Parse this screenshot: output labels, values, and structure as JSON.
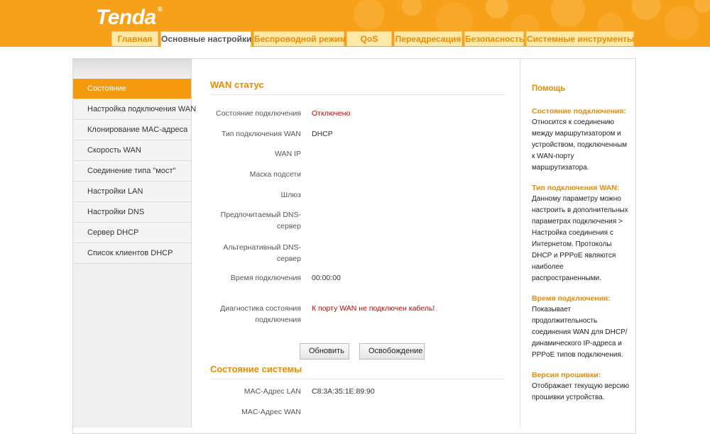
{
  "brand": {
    "logo": "Tenda",
    "registered": "®"
  },
  "nav": {
    "tabs": [
      {
        "label": "Главная",
        "active": false
      },
      {
        "label": "Основные настройки",
        "active": true
      },
      {
        "label": "Беспроводной режим",
        "active": false
      },
      {
        "label": "QoS",
        "active": false
      },
      {
        "label": "Переадресация",
        "active": false
      },
      {
        "label": "Безопасность",
        "active": false
      },
      {
        "label": "Системные инструменты",
        "active": false
      }
    ]
  },
  "sidebar": {
    "items": [
      {
        "label": "Состояние",
        "active": true
      },
      {
        "label": "Настройка подключения WAN",
        "active": false
      },
      {
        "label": "Клонирование MAC-адреса",
        "active": false
      },
      {
        "label": "Скорость WAN",
        "active": false
      },
      {
        "label": "Соединение типа \"мост\"",
        "active": false
      },
      {
        "label": "Настройки LAN",
        "active": false
      },
      {
        "label": "Настройки DNS",
        "active": false
      },
      {
        "label": "Сервер DHCP",
        "active": false
      },
      {
        "label": "Список клиентов DHCP",
        "active": false
      }
    ]
  },
  "main": {
    "wan_title": "WAN статус",
    "wan_rows": [
      {
        "label": "Состояние подключения",
        "value": "Отключено",
        "alert": true
      },
      {
        "label": "Тип подключения WAN",
        "value": "DHCP",
        "alert": false
      },
      {
        "label": "WAN IP",
        "value": "",
        "alert": false
      },
      {
        "label": "Маска подсети",
        "value": "",
        "alert": false
      },
      {
        "label": "Шлюз",
        "value": "",
        "alert": false
      },
      {
        "label": "Предпочитаемый DNS-сервер",
        "value": "",
        "alert": false
      },
      {
        "label": "Альтернативный DNS-сервер",
        "value": "",
        "alert": false
      },
      {
        "label": "Время подключения",
        "value": "00:00:00",
        "alert": false
      },
      {
        "label": "Диагностика состояния подключения",
        "value": "К порту WAN не подключен кабель!",
        "alert": true
      }
    ],
    "buttons": {
      "refresh": "Обновить",
      "release": "Освобождение"
    },
    "system_title": "Состояние системы",
    "system_rows": [
      {
        "label": "MAC-Адрес LAN",
        "value": "C8:3A:35:1E:89:90"
      },
      {
        "label": "MAC-Адрес WAN",
        "value": ""
      }
    ]
  },
  "help": {
    "title": "Помощь",
    "sections": [
      {
        "heading": "Состояние подключения:",
        "text": "Относится к соединению между маршрутизатором и устройством, подключенным к WAN-порту маршрутизатора."
      },
      {
        "heading": "Тип подключения WAN:",
        "text": "Данному параметру можно настроить в дополнительных параметрах подключения > Настройка соединения с Интернетом. Протоколы DHCP и PPPoE являются наиболее распространенными."
      },
      {
        "heading": "Время подключения:",
        "text": "Показывает продолжительность соединения WAN для DHCP/ динамического IP-адреса и PPPoE типов подключения."
      },
      {
        "heading": "Версия прошивки:",
        "text": "Отображает текущую версию прошивки устройства."
      }
    ]
  },
  "colors": {
    "accent": "#f7a11a",
    "active": "#f59a0f",
    "alert": "#d40000"
  }
}
